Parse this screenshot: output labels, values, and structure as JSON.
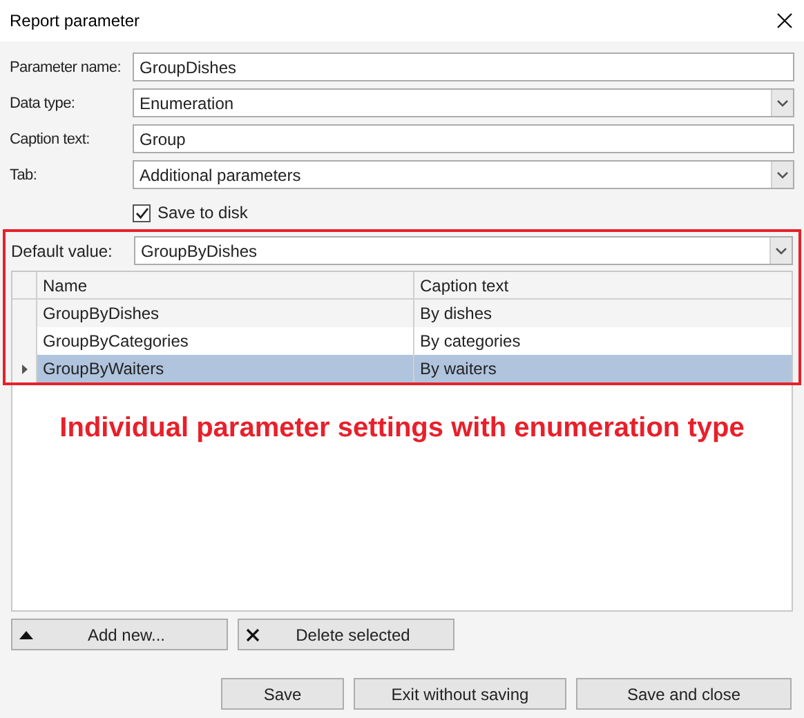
{
  "window": {
    "title": "Report parameter"
  },
  "fields": [
    {
      "label": "Parameter name:",
      "kind": "text",
      "value": "GroupDishes"
    },
    {
      "label": "Data type:",
      "kind": "select",
      "value": "Enumeration"
    },
    {
      "label": "Caption text:",
      "kind": "text",
      "value": "Group"
    },
    {
      "label": "Tab:",
      "kind": "select",
      "value": "Additional parameters"
    }
  ],
  "save_to_disk": {
    "label": "Save to disk",
    "checked": true
  },
  "default_value": {
    "label": "Default value:",
    "value": "GroupByDishes"
  },
  "table": {
    "columns": [
      "Name",
      "Caption text"
    ],
    "rows": [
      {
        "cells": [
          "GroupByDishes",
          "By dishes"
        ],
        "selected": false
      },
      {
        "cells": [
          "GroupByCategories",
          "By categories"
        ],
        "selected": false
      },
      {
        "cells": [
          "GroupByWaiters",
          "By waiters"
        ],
        "selected": true
      }
    ]
  },
  "annotation": "Individual parameter settings with enumeration type",
  "table_buttons": [
    {
      "label": "Add new...",
      "kind": "add"
    },
    {
      "label": "Delete selected",
      "kind": "delete"
    }
  ],
  "footer_buttons": [
    "Save",
    "Exit without saving",
    "Save and close"
  ]
}
